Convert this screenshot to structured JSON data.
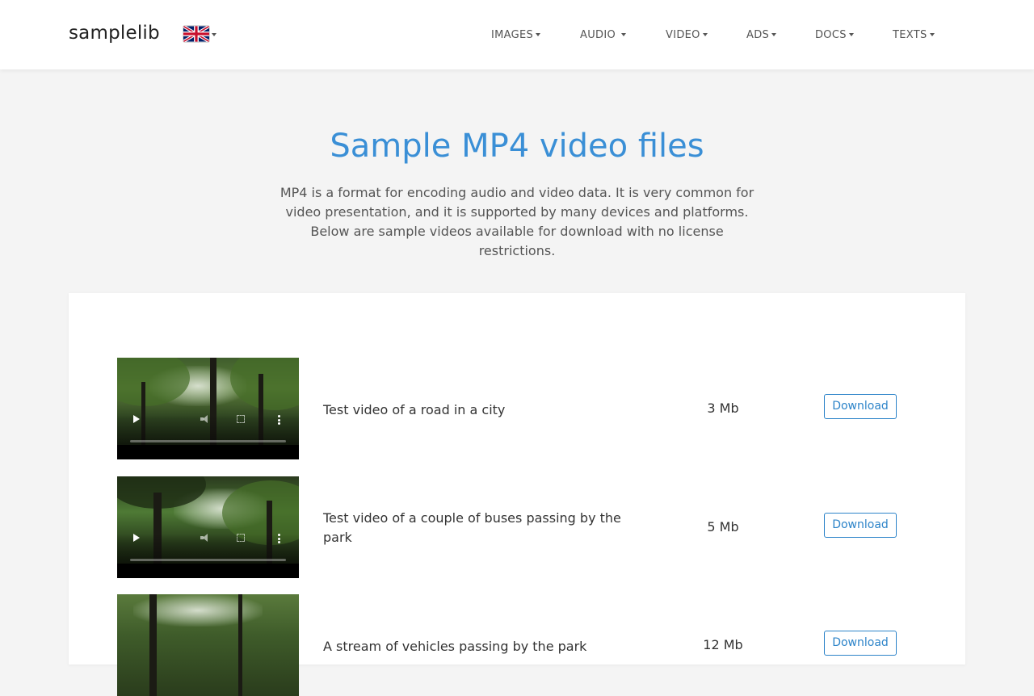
{
  "brand": "samplelib",
  "language": {
    "icon": "uk-flag-icon"
  },
  "nav": [
    {
      "label": "IMAGES",
      "icon": "caret-down-icon"
    },
    {
      "label": "AUDIO",
      "icon": "caret-down-icon"
    },
    {
      "label": "VIDEO",
      "icon": "caret-down-icon"
    },
    {
      "label": "ADS",
      "icon": "caret-down-icon"
    },
    {
      "label": "DOCS",
      "icon": "caret-down-icon"
    },
    {
      "label": "TEXTS",
      "icon": "caret-down-icon"
    }
  ],
  "page": {
    "title": "Sample MP4 video files",
    "intro": "MP4 is a format for encoding audio and video data. It is very common for video presentation, and it is supported by many devices and platforms. Below are sample videos available for download with no license restrictions."
  },
  "videos": [
    {
      "description": "Test video of a road in a city",
      "size": "3 Mb",
      "button": "Download"
    },
    {
      "description": "Test video of a couple of buses passing by the park",
      "size": "5 Mb",
      "button": "Download"
    },
    {
      "description": "A stream of vehicles passing by the park",
      "size": "12 Mb",
      "button": "Download"
    }
  ],
  "colors": {
    "accent": "#3a8fd6",
    "button": "#2d84c9",
    "background": "#f4f4f4"
  }
}
